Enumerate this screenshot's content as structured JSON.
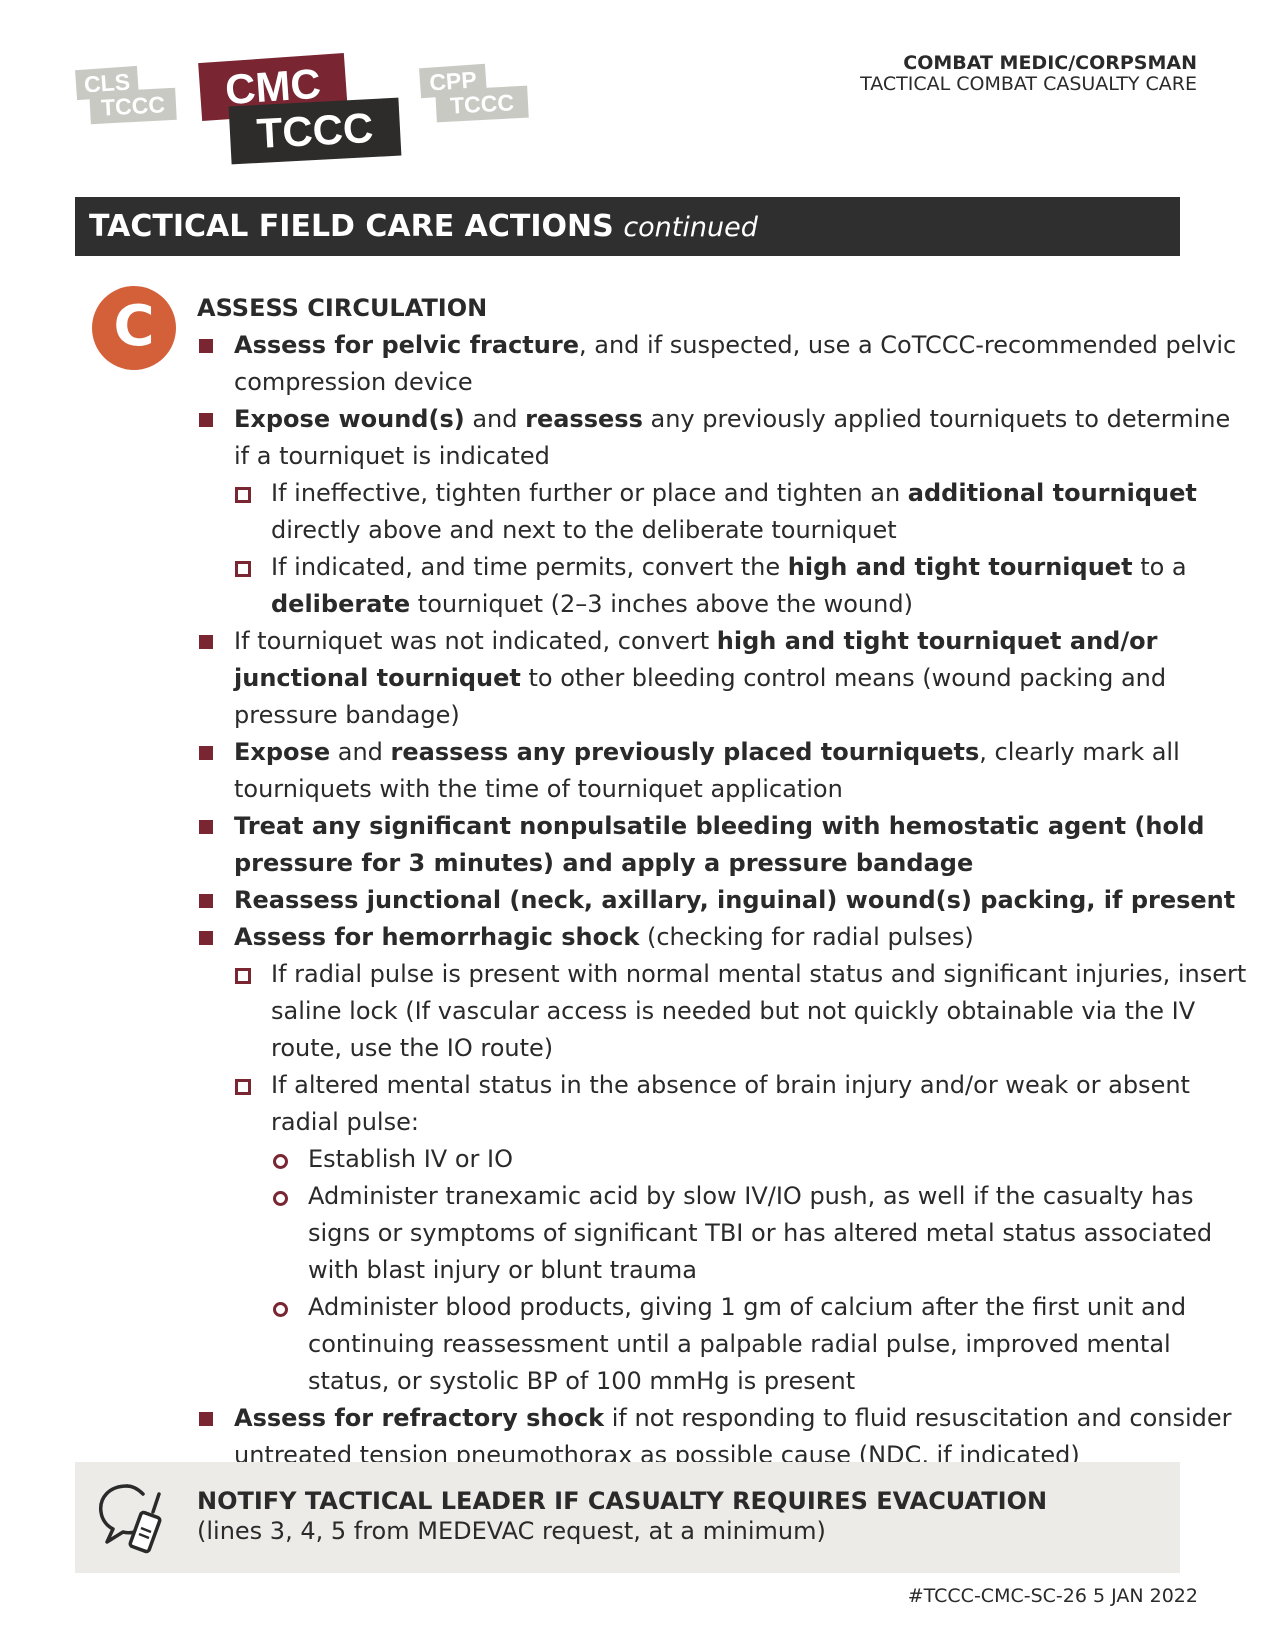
{
  "logos": {
    "cls": [
      "CLS",
      "TCCC"
    ],
    "cmc": [
      "CMC",
      "TCCC"
    ],
    "cpp": [
      "CPP",
      "TCCC"
    ]
  },
  "header": {
    "line1": "COMBAT MEDIC/CORPSMAN",
    "line2": "TACTICAL COMBAT CASUALTY CARE"
  },
  "section": {
    "title": "TACTICAL FIELD CARE ACTIONS",
    "suffix": "continued"
  },
  "circulation": {
    "letter": "C",
    "heading": "ASSESS CIRCULATION",
    "items": [
      {
        "level": 1,
        "parts": [
          {
            "b": "Assess for pelvic fracture"
          },
          {
            "t": ", and if suspected, use a CoTCCC-recommended pelvic compression device"
          }
        ]
      },
      {
        "level": 1,
        "parts": [
          {
            "b": "Expose wound(s)"
          },
          {
            "t": " and "
          },
          {
            "b": "reassess"
          },
          {
            "t": " any previously applied tourniquets to determine if a tourniquet is indicated"
          }
        ]
      },
      {
        "level": 2,
        "parts": [
          {
            "t": "If ineffective, tighten further or place and tighten an "
          },
          {
            "b": "additional tourniquet"
          },
          {
            "t": " directly above and next to the deliberate tourniquet"
          }
        ]
      },
      {
        "level": 2,
        "parts": [
          {
            "t": "If indicated, and time permits, convert the "
          },
          {
            "b": "high and tight tourniquet"
          },
          {
            "t": " to a "
          },
          {
            "b": "deliberate"
          },
          {
            "t": " tourniquet (2–3 inches above the wound)"
          }
        ]
      },
      {
        "level": 1,
        "parts": [
          {
            "t": "If tourniquet was not indicated, convert "
          },
          {
            "b": "high and tight tourniquet and/or junctional tourniquet"
          },
          {
            "t": " to other bleeding control means (wound packing and pressure bandage)"
          }
        ]
      },
      {
        "level": 1,
        "parts": [
          {
            "b": "Expose"
          },
          {
            "t": " and "
          },
          {
            "b": "reassess any previously placed tourniquets"
          },
          {
            "t": ", clearly mark all tourniquets with the time of tourniquet application"
          }
        ]
      },
      {
        "level": 1,
        "parts": [
          {
            "b": "Treat any significant nonpulsatile bleeding with hemostatic agent (hold pressure for 3 minutes) and apply a pressure bandage"
          }
        ]
      },
      {
        "level": 1,
        "parts": [
          {
            "b": "Reassess junctional (neck, axillary, inguinal) wound(s) packing, if present"
          }
        ]
      },
      {
        "level": 1,
        "parts": [
          {
            "b": "Assess for hemorrhagic shock"
          },
          {
            "t": " (checking for radial pulses)"
          }
        ]
      },
      {
        "level": 2,
        "parts": [
          {
            "t": "If radial pulse is present with normal mental status and significant injuries, insert saline lock (If vascular access is needed but not quickly obtainable via the IV route, use the IO route)"
          }
        ]
      },
      {
        "level": 2,
        "parts": [
          {
            "t": "If altered mental status in the absence of brain injury and/or weak or absent radial pulse:"
          }
        ]
      },
      {
        "level": 3,
        "parts": [
          {
            "t": "Establish IV or IO"
          }
        ]
      },
      {
        "level": 3,
        "parts": [
          {
            "t": "Administer tranexamic acid by slow IV/IO push, as well if the casualty has signs or symptoms of significant TBI or has altered metal status associated with blast injury or blunt trauma"
          }
        ]
      },
      {
        "level": 3,
        "parts": [
          {
            "t": "Administer blood products, giving 1 gm of calcium after the first unit and continuing reassessment until a palpable radial pulse, improved mental status, or systolic BP of 100 mmHg is present"
          }
        ]
      },
      {
        "level": 1,
        "parts": [
          {
            "b": "Assess for refractory shock"
          },
          {
            "t": " if not responding to fluid resuscitation and consider untreated tension pneumothorax as possible cause (NDC, if indicated)"
          }
        ]
      }
    ]
  },
  "notify": {
    "icon": "radio-speech-icon",
    "title": "NOTIFY TACTICAL LEADER IF CASUALTY REQUIRES EVACUATION",
    "subtitle": "(lines 3, 4, 5 from MEDEVAC request, at a minimum)"
  },
  "footer": {
    "code": "#TCCC-CMC-SC-26  5 JAN 2022"
  },
  "colors": {
    "accent": "#7a2632",
    "circle": "#d4603a",
    "bar": "#2f2f2f",
    "notify_bg": "#ecebe8"
  }
}
